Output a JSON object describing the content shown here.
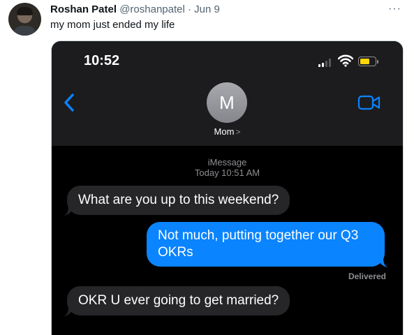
{
  "tweet": {
    "display_name": "Roshan Patel",
    "handle": "@roshanpatel",
    "separator": "·",
    "date": "Jun 9",
    "more_icon": "···",
    "text": "my mom just ended my life"
  },
  "phone": {
    "status_time": "10:52",
    "contact_initial": "M",
    "contact_name": "Mom",
    "contact_chevron": ">",
    "service": "iMessage",
    "timestamp": "Today 10:51 AM",
    "messages": [
      {
        "from": "them",
        "text": "What are you up to this weekend?"
      },
      {
        "from": "me",
        "line1": "Not much, putting together our Q3",
        "line2": "OKRs"
      },
      {
        "from": "them",
        "text": "OKR U ever going to get married?"
      }
    ],
    "delivered": "Delivered"
  },
  "colors": {
    "imessage_blue": "#0a84ff",
    "received_bubble": "#262629",
    "battery_yellow": "#ffd60a"
  }
}
